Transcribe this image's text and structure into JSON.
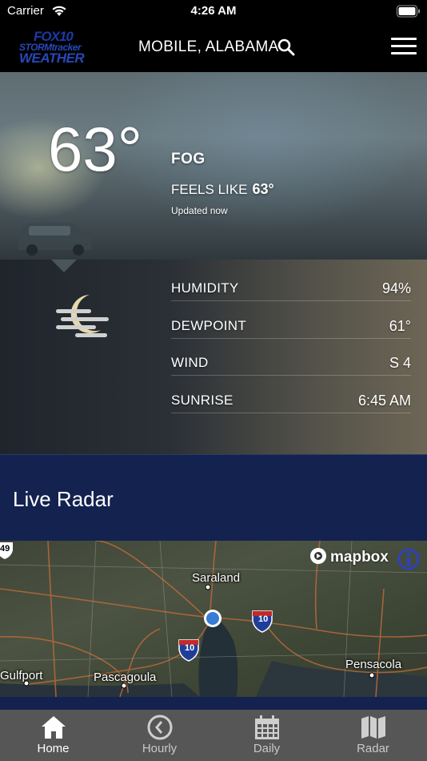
{
  "status_bar": {
    "carrier": "Carrier",
    "time": "4:26 AM"
  },
  "header": {
    "logo": {
      "line1": "FOX10",
      "line2": "STORMtracker",
      "line3": "WEATHER"
    },
    "location": "MOBILE, ALABAMA"
  },
  "current": {
    "temperature": "63°",
    "condition": "FOG",
    "feels_like_label": "FEELS LIKE",
    "feels_like_value": "63°",
    "updated": "Updated now"
  },
  "details": [
    {
      "label": "HUMIDITY",
      "value": "94%"
    },
    {
      "label": "DEWPOINT",
      "value": "61°"
    },
    {
      "label": "WIND",
      "value": "S 4"
    },
    {
      "label": "SUNRISE",
      "value": "6:45 AM"
    }
  ],
  "radar": {
    "title": "Live Radar",
    "attribution": "mapbox",
    "labels": {
      "city1": "Saraland",
      "city2": "Gulfport",
      "city3": "Pascagoula",
      "city4": "Pensacola",
      "route_a": "10",
      "route_b": "10",
      "route_c": "49"
    }
  },
  "tabs": [
    {
      "label": "Home",
      "icon": "home-icon",
      "active": true
    },
    {
      "label": "Hourly",
      "icon": "clock-icon",
      "active": false
    },
    {
      "label": "Daily",
      "icon": "calendar-icon",
      "active": false
    },
    {
      "label": "Radar",
      "icon": "map-icon",
      "active": false
    }
  ],
  "colors": {
    "navy": "#13224f",
    "tab_bar": "#565656",
    "logo_blue": "#2748b8"
  }
}
